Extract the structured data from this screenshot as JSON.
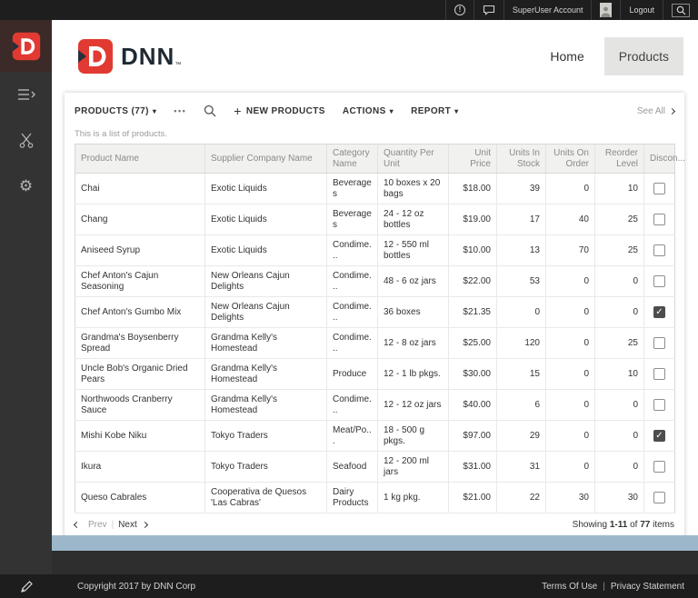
{
  "brand": {
    "name": "DNN",
    "tm": "™",
    "accent_red": "#e13a32",
    "dark_navy": "#25303b",
    "band_blue": "#9cb7ca"
  },
  "topbar": {
    "account_label": "SuperUser Account",
    "logout_label": "Logout"
  },
  "icons": {
    "notification": "!",
    "chat": "speech-bubble",
    "search": "magnifier",
    "avatar": "person-silhouette",
    "content": "list-lines",
    "tools": "scissors",
    "settings": "⚙",
    "edit": "pencil",
    "caret_down": "▾",
    "checkmark": "✓"
  },
  "nav": {
    "home": "Home",
    "products": "Products"
  },
  "toolbar": {
    "title": "PRODUCTS (77)",
    "more": "•••",
    "new": "NEW PRODUCTS",
    "actions": "ACTIONS",
    "report": "REPORT",
    "see_all": "See All"
  },
  "subtitle": "This is a list of products.",
  "table": {
    "columns": [
      "Product Name",
      "Supplier Company Name",
      "Category Name",
      "Quantity Per Unit",
      "Unit Price",
      "Units In Stock",
      "Units On Order",
      "Reorder Level",
      "Discon..."
    ],
    "rows": [
      {
        "product": "Chai",
        "supplier": "Exotic Liquids",
        "category": "Beverages",
        "quantity": "10 boxes x 20 bags",
        "unit_price": "$18.00",
        "units_in_stock": "39",
        "units_on_order": "0",
        "reorder_level": "10",
        "discontinued": false
      },
      {
        "product": "Chang",
        "supplier": "Exotic Liquids",
        "category": "Beverages",
        "quantity": "24 - 12 oz bottles",
        "unit_price": "$19.00",
        "units_in_stock": "17",
        "units_on_order": "40",
        "reorder_level": "25",
        "discontinued": false
      },
      {
        "product": "Aniseed Syrup",
        "supplier": "Exotic Liquids",
        "category": "Condime...",
        "quantity": "12 - 550 ml bottles",
        "unit_price": "$10.00",
        "units_in_stock": "13",
        "units_on_order": "70",
        "reorder_level": "25",
        "discontinued": false
      },
      {
        "product": "Chef Anton's Cajun Seasoning",
        "supplier": "New Orleans Cajun Delights",
        "category": "Condime...",
        "quantity": "48 - 6 oz jars",
        "unit_price": "$22.00",
        "units_in_stock": "53",
        "units_on_order": "0",
        "reorder_level": "0",
        "discontinued": false
      },
      {
        "product": "Chef Anton's Gumbo Mix",
        "supplier": "New Orleans Cajun Delights",
        "category": "Condime...",
        "quantity": "36 boxes",
        "unit_price": "$21.35",
        "units_in_stock": "0",
        "units_on_order": "0",
        "reorder_level": "0",
        "discontinued": true
      },
      {
        "product": "Grandma's Boysenberry Spread",
        "supplier": "Grandma Kelly's Homestead",
        "category": "Condime...",
        "quantity": "12 - 8 oz jars",
        "unit_price": "$25.00",
        "units_in_stock": "120",
        "units_on_order": "0",
        "reorder_level": "25",
        "discontinued": false
      },
      {
        "product": "Uncle Bob's Organic Dried Pears",
        "supplier": "Grandma Kelly's Homestead",
        "category": "Produce",
        "quantity": "12 - 1 lb pkgs.",
        "unit_price": "$30.00",
        "units_in_stock": "15",
        "units_on_order": "0",
        "reorder_level": "10",
        "discontinued": false
      },
      {
        "product": "Northwoods Cranberry Sauce",
        "supplier": "Grandma Kelly's Homestead",
        "category": "Condime...",
        "quantity": "12 - 12 oz jars",
        "unit_price": "$40.00",
        "units_in_stock": "6",
        "units_on_order": "0",
        "reorder_level": "0",
        "discontinued": false
      },
      {
        "product": "Mishi Kobe Niku",
        "supplier": "Tokyo Traders",
        "category": "Meat/Po...",
        "quantity": "18 - 500 g pkgs.",
        "unit_price": "$97.00",
        "units_in_stock": "29",
        "units_on_order": "0",
        "reorder_level": "0",
        "discontinued": true
      },
      {
        "product": "Ikura",
        "supplier": "Tokyo Traders",
        "category": "Seafood",
        "quantity": "12 - 200 ml jars",
        "unit_price": "$31.00",
        "units_in_stock": "31",
        "units_on_order": "0",
        "reorder_level": "0",
        "discontinued": false
      },
      {
        "product": "Queso Cabrales",
        "supplier": "Cooperativa de Quesos 'Las Cabras'",
        "category": "Dairy Products",
        "quantity": "1 kg pkg.",
        "unit_price": "$21.00",
        "units_in_stock": "22",
        "units_on_order": "30",
        "reorder_level": "30",
        "discontinued": false
      }
    ]
  },
  "pagination": {
    "prev": "Prev",
    "next": "Next",
    "showing_prefix": "Showing",
    "range": "1-11",
    "of": "of",
    "total": "77",
    "items": "items"
  },
  "footer": {
    "copyright": "Copyright 2017 by DNN Corp",
    "terms": "Terms Of Use",
    "privacy": "Privacy Statement"
  }
}
